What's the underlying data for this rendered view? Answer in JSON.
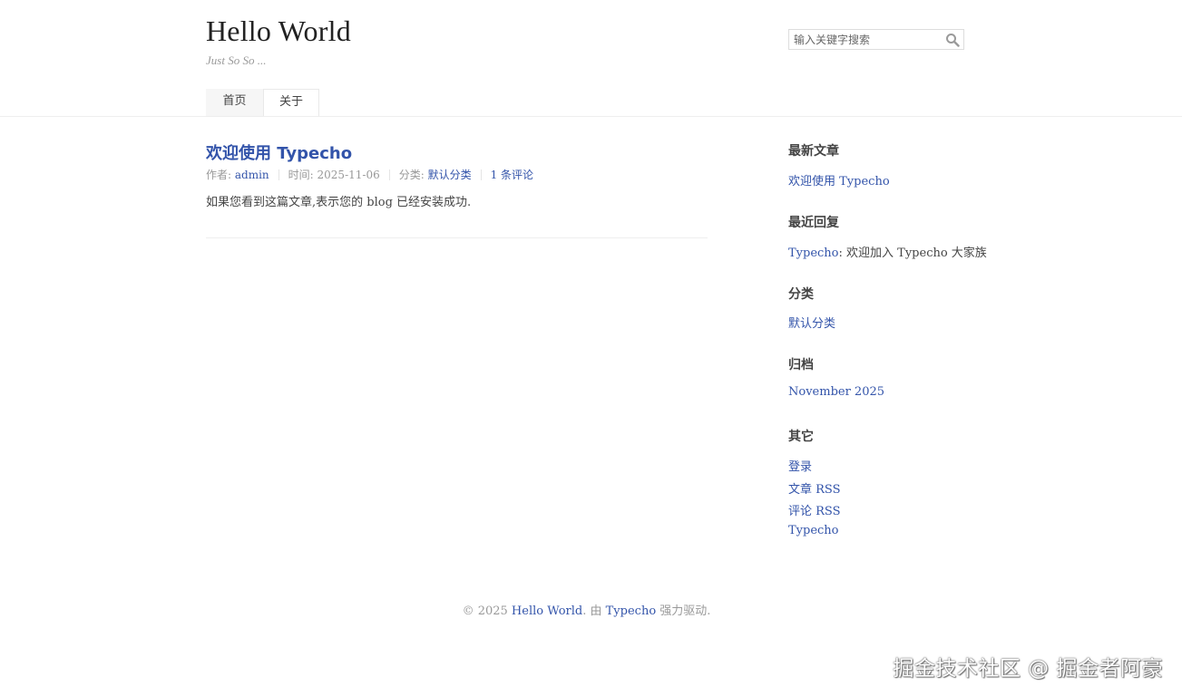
{
  "header": {
    "title": "Hello World",
    "description": "Just So So ..."
  },
  "search": {
    "placeholder": "输入关键字搜索",
    "button_icon": "search-icon"
  },
  "nav": {
    "items": [
      {
        "label": "首页",
        "active": true
      },
      {
        "label": "关于",
        "active": false
      }
    ]
  },
  "post": {
    "title": "欢迎使用 Typecho",
    "meta": {
      "author_label": "作者:",
      "author": "admin",
      "time_label": "时间:",
      "time": "2025-11-06",
      "category_label": "分类:",
      "category": "默认分类",
      "comments": "1 条评论"
    },
    "content": "如果您看到这篇文章,表示您的 blog 已经安装成功."
  },
  "sidebar": {
    "recent_posts": {
      "title": "最新文章",
      "items": [
        "欢迎使用 Typecho"
      ]
    },
    "recent_comments": {
      "title": "最近回复",
      "items": [
        {
          "author": "Typecho",
          "text": ": 欢迎加入 Typecho 大家族"
        }
      ]
    },
    "categories": {
      "title": "分类",
      "items": [
        "默认分类"
      ]
    },
    "archives": {
      "title": "归档",
      "items": [
        "November 2025"
      ]
    },
    "misc": {
      "title": "其它",
      "items": [
        "登录",
        "文章 RSS",
        "评论 RSS",
        "Typecho"
      ]
    }
  },
  "footer": {
    "copyright": "© 2025",
    "site_link": "Hello World",
    "middle": ". 由",
    "powered_link": "Typecho",
    "suffix": "强力驱动."
  },
  "watermark": "掘金技术社区 @ 掘金者阿豪",
  "colors": {
    "link": "#3354AA",
    "text": "#444444",
    "muted": "#999999",
    "border": "#eeeeee"
  }
}
